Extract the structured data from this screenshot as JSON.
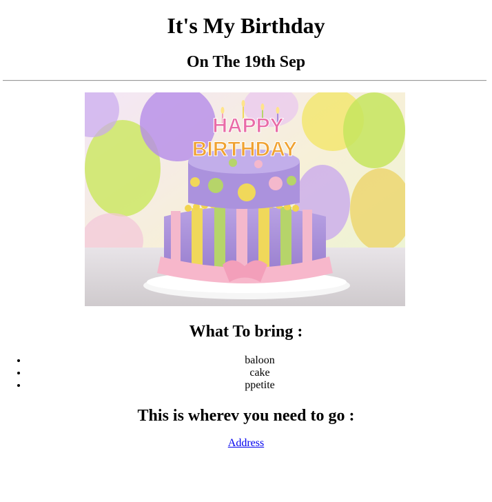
{
  "header": {
    "title": "It's My Birthday",
    "subtitle": "On The 19th Sep"
  },
  "image": {
    "icon": "birthday-cake-photo",
    "cake_text_line1": "HAPPY",
    "cake_text_line2": "BIRTHDAY",
    "colors": {
      "balloon_purple": "#b58ce8",
      "balloon_green": "#c9e65a",
      "balloon_yellow": "#f2e66a",
      "cake_purple": "#a68bd8",
      "cake_pink": "#f4b8cc",
      "cake_yellow": "#f0d85a",
      "cake_green": "#b6d46a"
    }
  },
  "bring": {
    "title": "What To bring :",
    "items": [
      "baloon",
      "cake",
      "ppetite"
    ]
  },
  "directions": {
    "title": "This is wherev you need to go :",
    "link_label": "Address"
  }
}
